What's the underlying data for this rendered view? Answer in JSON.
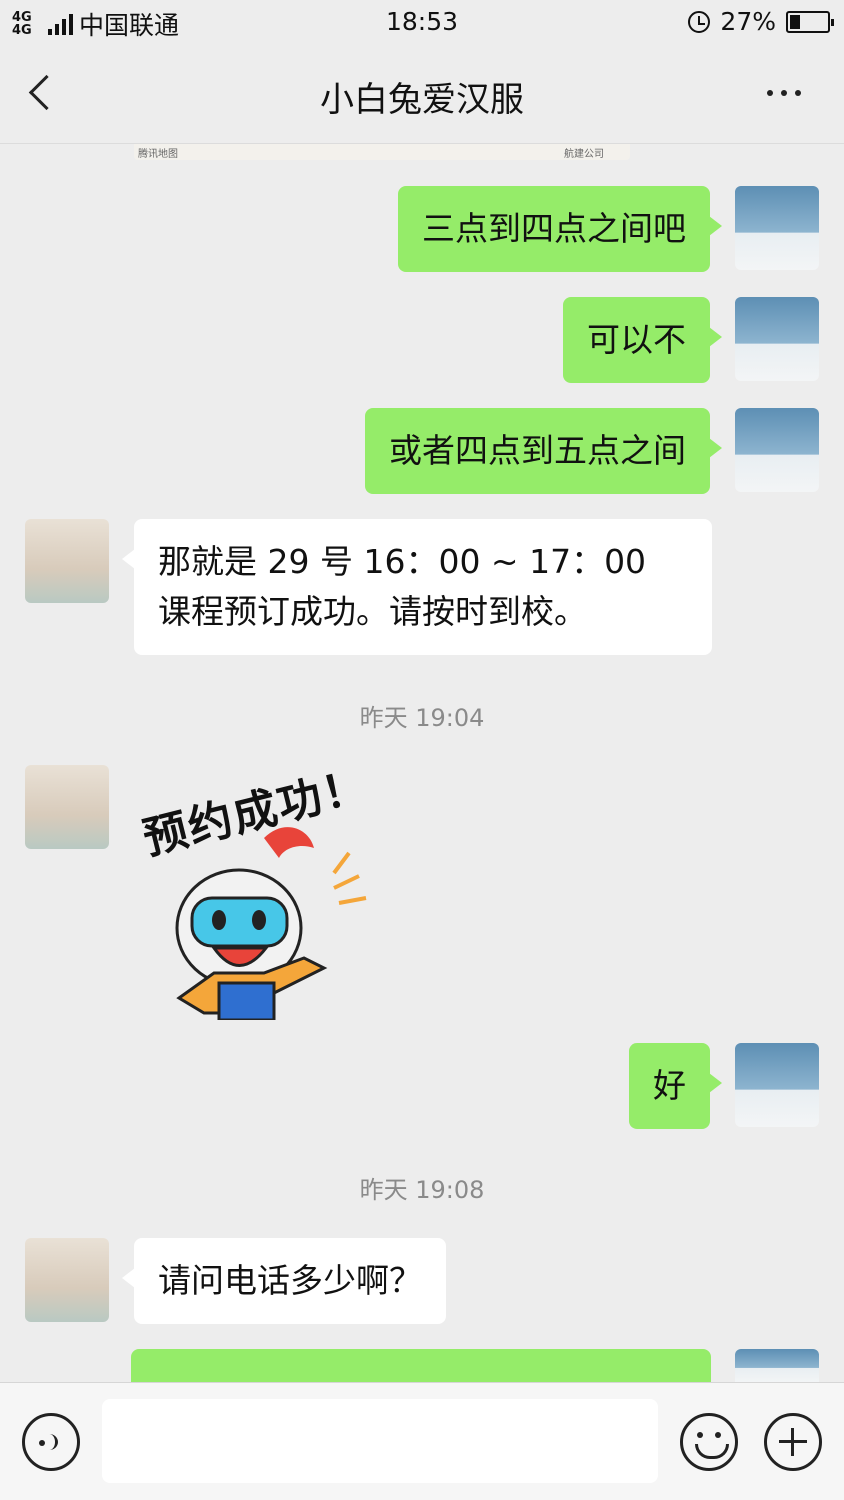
{
  "status_bar": {
    "network": "4G 4G",
    "carrier": "中国联通",
    "time": "18:53",
    "battery": "27%",
    "battery_level": 0.27
  },
  "header": {
    "title": "小白兔爱汉服"
  },
  "map_preview": {
    "provider": "腾讯地图",
    "labels": [
      "航建公司"
    ]
  },
  "messages": [
    {
      "side": "right",
      "text": "三点到四点之间吧"
    },
    {
      "side": "right",
      "text": "可以不"
    },
    {
      "side": "right",
      "text": "或者四点到五点之间"
    },
    {
      "side": "left",
      "text": "那就是 29 号 16：00 ~ 17：00 课程预订成功。请按时到校。"
    },
    {
      "side": "left",
      "sticker_text": "预约成功！"
    },
    {
      "side": "right",
      "text": "好"
    },
    {
      "side": "left",
      "text": "请问电话多少啊？"
    }
  ],
  "timestamps": [
    "昨天 19:04",
    "昨天 19:08"
  ],
  "input_bar": {
    "voice_icon": "voice-icon",
    "emoji_icon": "emoji-icon",
    "plus_icon": "plus-icon",
    "value": ""
  },
  "colors": {
    "background": "#ededed",
    "bubble_green": "#95ec69",
    "bubble_white": "#ffffff"
  }
}
